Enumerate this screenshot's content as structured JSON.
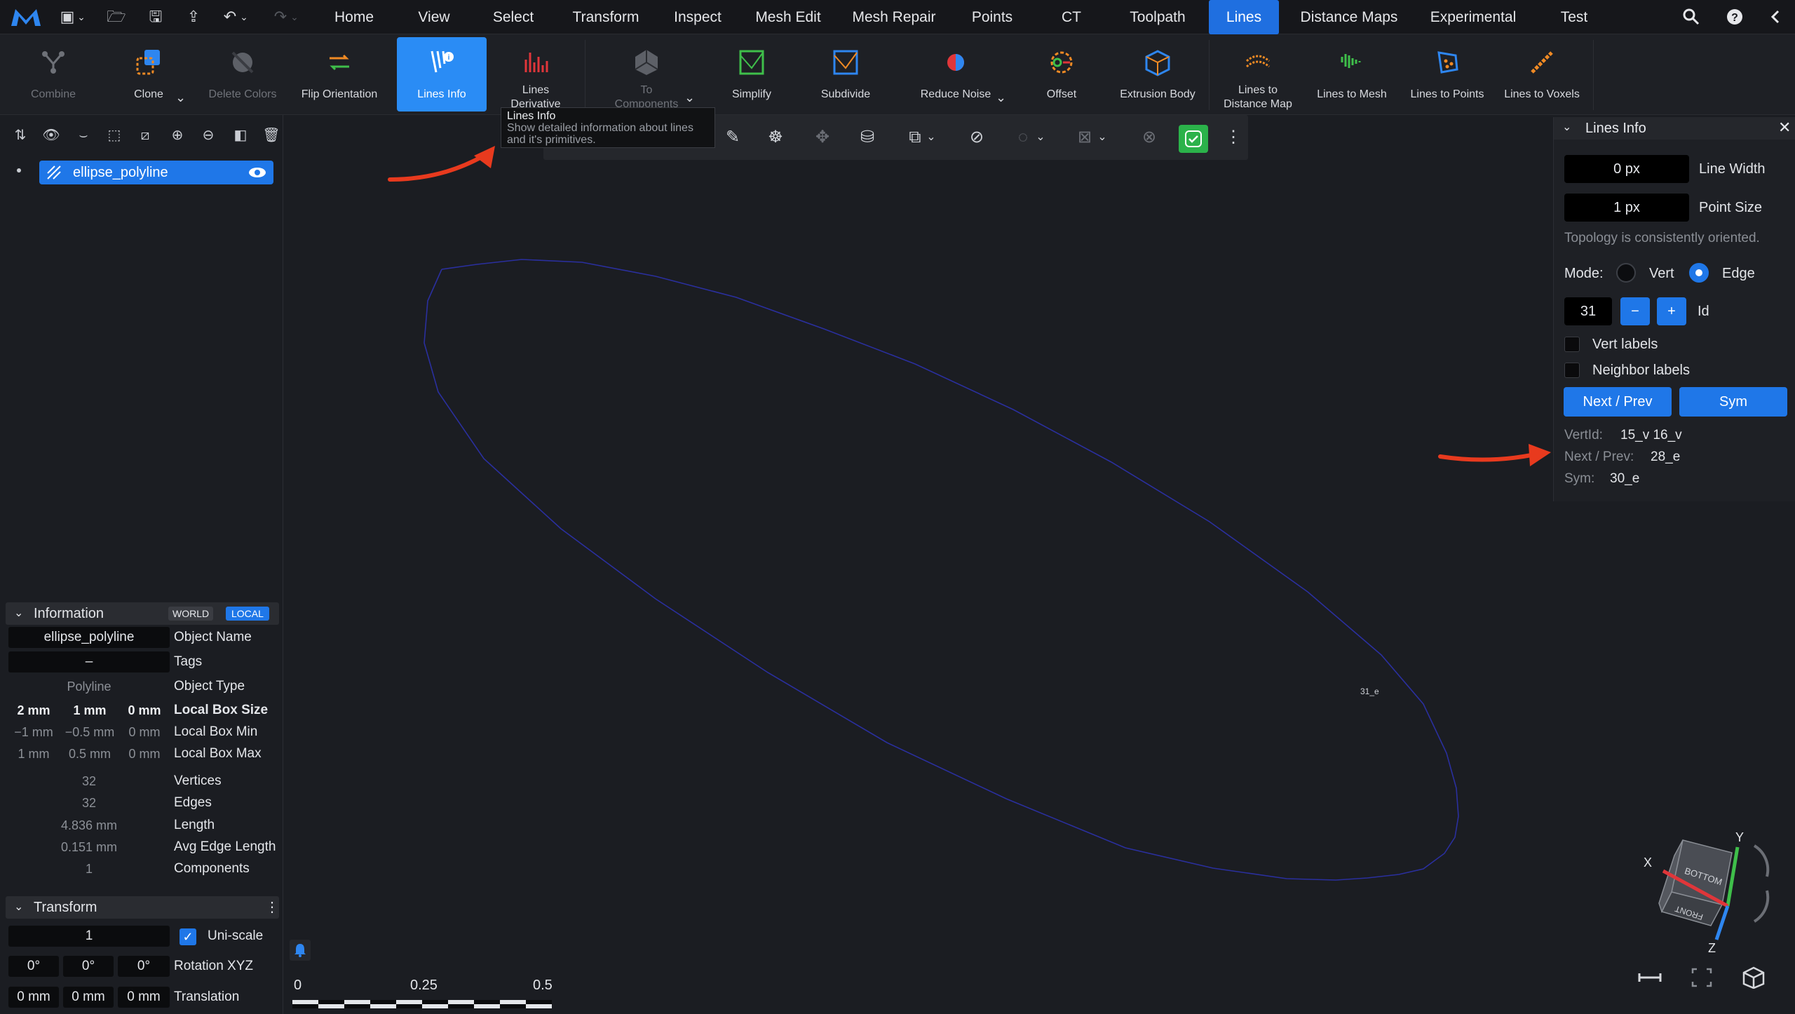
{
  "menu": {
    "tabs": [
      "Home",
      "View",
      "Select",
      "Transform",
      "Inspect",
      "Mesh Edit",
      "Mesh Repair",
      "Points",
      "CT",
      "Toolpath",
      "Lines",
      "Distance Maps",
      "Experimental",
      "Test"
    ],
    "active": "Lines"
  },
  "ribbon": {
    "combine": "Combine",
    "clone": "Clone",
    "delete_colors": "Delete Colors",
    "flip_orientation": "Flip Orientation",
    "lines_info": "Lines Info",
    "lines_derivative": "Lines\nDerivative",
    "to_components": "To\nComponents",
    "simplify": "Simplify",
    "subdivide": "Subdivide",
    "reduce_noise": "Reduce Noise",
    "offset": "Offset",
    "extrusion_body": "Extrusion Body",
    "lines_to_distance_map": "Lines to\nDistance Map",
    "lines_to_mesh": "Lines to Mesh",
    "lines_to_points": "Lines to Points",
    "lines_to_voxels": "Lines to Voxels"
  },
  "tooltip": {
    "title": "Lines Info",
    "body": "Show detailed information about lines and it's primitives."
  },
  "scene": {
    "object_name": "ellipse_polyline"
  },
  "information": {
    "header": "Information",
    "world": "WORLD",
    "local": "LOCAL",
    "name_value": "ellipse_polyline",
    "name_label": "Object Name",
    "tags_value": "–",
    "tags_label": "Tags",
    "type_value": "Polyline",
    "type_label": "Object Type",
    "box_size": [
      "2 mm",
      "1 mm",
      "0 mm"
    ],
    "box_size_label": "Local Box Size",
    "box_min": [
      "−1 mm",
      "−0.5 mm",
      "0 mm"
    ],
    "box_min_label": "Local Box Min",
    "box_max": [
      "1 mm",
      "0.5 mm",
      "0 mm"
    ],
    "box_max_label": "Local Box Max",
    "vertices": "32",
    "vertices_label": "Vertices",
    "edges": "32",
    "edges_label": "Edges",
    "length": "4.836 mm",
    "length_label": "Length",
    "avg_edge": "0.151 mm",
    "avg_edge_label": "Avg Edge Length",
    "components": "1",
    "components_label": "Components"
  },
  "transform": {
    "header": "Transform",
    "scale": "1",
    "uniscale_label": "Uni-scale",
    "rotation": [
      "0°",
      "0°",
      "0°"
    ],
    "rotation_label": "Rotation XYZ",
    "translation": [
      "0 mm",
      "0 mm",
      "0 mm"
    ],
    "translation_label": "Translation"
  },
  "lines_info_panel": {
    "title": "Lines Info",
    "line_width_value": "0 px",
    "line_width_label": "Line Width",
    "point_size_value": "1 px",
    "point_size_label": "Point Size",
    "topology_note": "Topology is consistently oriented.",
    "mode_label": "Mode:",
    "mode_vert": "Vert",
    "mode_edge": "Edge",
    "id_value": "31",
    "minus": "−",
    "plus": "+",
    "id_label": "Id",
    "vert_labels": "Vert labels",
    "neighbor_labels": "Neighbor labels",
    "next_prev_button": "Next / Prev",
    "sym_button": "Sym",
    "vertid_label": "VertId:",
    "vertid_value": "15_v 16_v",
    "next_prev_label": "Next / Prev:",
    "next_prev_value": "28_e",
    "sym_label": "Sym:",
    "sym_value": "30_e"
  },
  "viewport": {
    "edge_label": "31_e",
    "scale_ticks": [
      "0",
      "0.25",
      "0.5"
    ],
    "axes": {
      "x": "X",
      "y": "Y",
      "z": "Z",
      "face_bottom": "BOTTOM",
      "face_front": "FRONT"
    }
  },
  "colors": {
    "accent": "#1f77e8",
    "ellipse": "#2a2f9e",
    "arrow": "#e83a1e"
  }
}
